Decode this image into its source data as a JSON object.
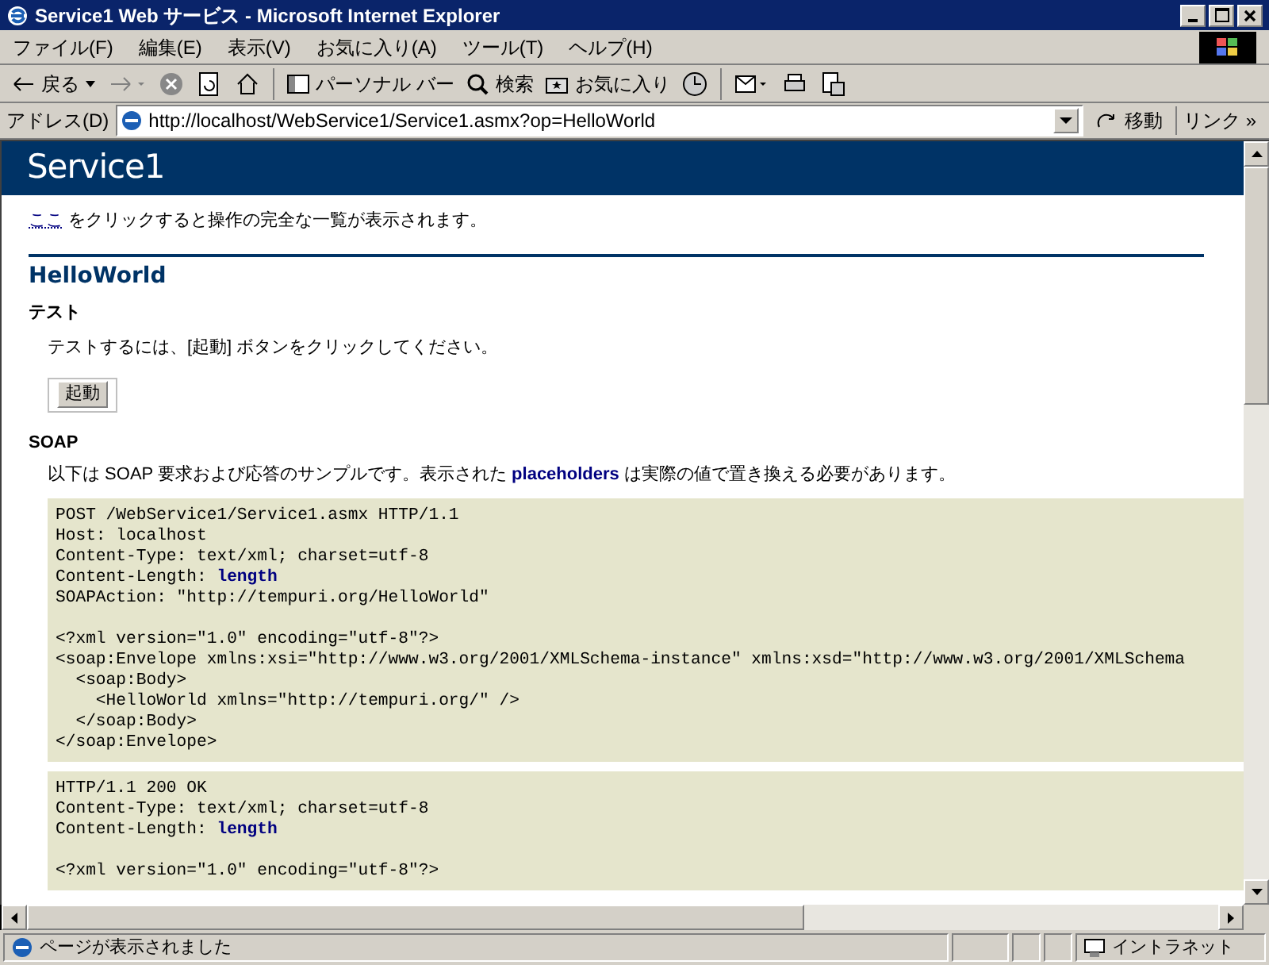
{
  "window": {
    "title": "Service1 Web サービス - Microsoft Internet Explorer"
  },
  "menu": [
    "ファイル(F)",
    "編集(E)",
    "表示(V)",
    "お気に入り(A)",
    "ツール(T)",
    "ヘルプ(H)"
  ],
  "toolbar": {
    "back": "戻る",
    "personal_bar": "パーソナル バー",
    "search": "検索",
    "favorites": "お気に入り"
  },
  "address_bar": {
    "label": "アドレス(D)",
    "value": "http://localhost/WebService1/Service1.asmx?op=HelloWorld",
    "go": "移動",
    "links": "リンク »"
  },
  "page": {
    "banner": "Service1",
    "intro_link": "ここ",
    "intro_text": "をクリックすると操作の完全な一覧が表示されます。",
    "operation": "HelloWorld",
    "test_heading": "テスト",
    "test_text": "テストするには、[起動] ボタンをクリックしてください。",
    "invoke_button": "起動",
    "soap_heading": "SOAP",
    "soap_text": "以下は SOAP 要求および応答のサンプルです。表示された **placeholders** は実際の値で置き換える必要があります。",
    "code_blocks": [
      {
        "sections": [
          [
            "POST /WebService1/Service1.asmx HTTP/1.1",
            "Host: localhost",
            "Content-Type: text/xml; charset=utf-8",
            "Content-Length: **length**",
            "SOAPAction: \"http://tempuri.org/HelloWorld\""
          ],
          [
            "<?xml version=\"1.0\" encoding=\"utf-8\"?>",
            "<soap:Envelope xmlns:xsi=\"http://www.w3.org/2001/XMLSchema-instance\" xmlns:xsd=\"http://www.w3.org/2001/XMLSchema",
            "  <soap:Body>",
            "    <HelloWorld xmlns=\"http://tempuri.org/\" />",
            "  </soap:Body>",
            "</soap:Envelope>"
          ]
        ]
      },
      {
        "sections": [
          [
            "HTTP/1.1 200 OK",
            "Content-Type: text/xml; charset=utf-8",
            "Content-Length: **length**"
          ],
          [
            "<?xml version=\"1.0\" encoding=\"utf-8\"?>"
          ]
        ]
      }
    ]
  },
  "status_bar": {
    "text": "ページが表示されました",
    "zone": "イントラネット"
  }
}
